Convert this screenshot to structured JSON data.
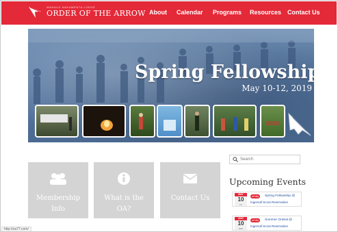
{
  "header": {
    "logo_small": "WAHAUX NAKAWENTA LODGE",
    "logo_title": "ORDER OF THE ARROW",
    "nav": [
      "About",
      "Calendar",
      "Programs",
      "Resources",
      "Contact Us"
    ]
  },
  "hero": {
    "title": "Spring Fellowship",
    "date": "May 10-12, 2019"
  },
  "tiles": [
    {
      "icon": "users-icon",
      "label": "Membership Info"
    },
    {
      "icon": "info-icon",
      "label": "What is the OA?"
    },
    {
      "icon": "envelope-icon",
      "label": "Contact Us"
    }
  ],
  "sidebar": {
    "search_placeholder": "Search",
    "upcoming_title": "Upcoming Events",
    "events": [
      {
        "month": "MAY",
        "day": "10",
        "dow": "Fri",
        "badge": "all day",
        "title": "Spring Fellowship @",
        "place": "Ingersoll Scout Reservation"
      },
      {
        "month": "AUG",
        "day": "10",
        "dow": "Wed",
        "badge": "all day",
        "title": "Summer Ordeal @",
        "place": "Ingersoll Scout Reservation"
      }
    ]
  },
  "status_bar": "http://oa77.com/",
  "colors": {
    "brand_red": "#e42938",
    "tile_gray": "#d4d4d4",
    "hero_blue": "#5a7aa3"
  }
}
